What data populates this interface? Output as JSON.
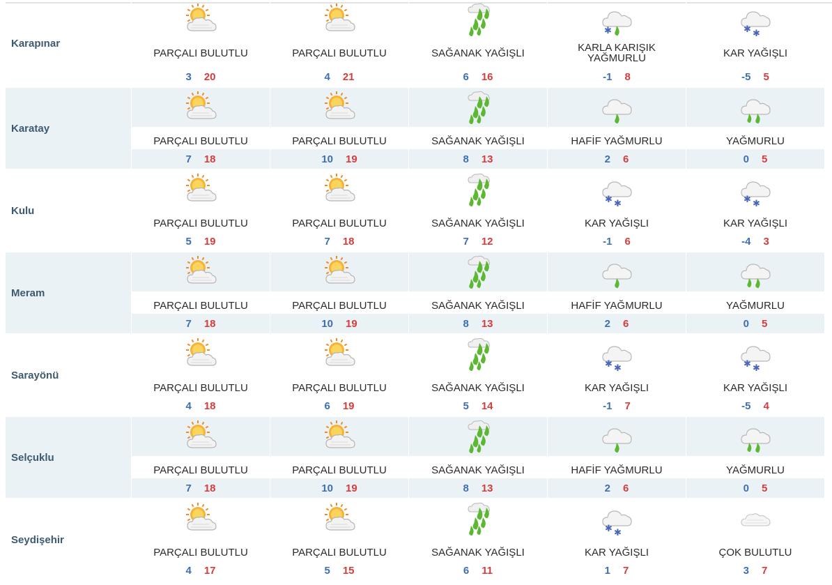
{
  "rows": [
    {
      "city": "Karapınar",
      "days": [
        {
          "icon": "partly-cloudy-icon",
          "condition": "PARÇALI BULUTLU",
          "min": "3",
          "max": "20"
        },
        {
          "icon": "partly-cloudy-icon",
          "condition": "PARÇALI BULUTLU",
          "min": "4",
          "max": "21"
        },
        {
          "icon": "shower-rain-icon",
          "condition": "SAĞANAK YAĞIŞLI",
          "min": "6",
          "max": "16"
        },
        {
          "icon": "sleet-icon",
          "condition": "KARLA KARIŞIK YAĞMURLU",
          "min": "-1",
          "max": "8"
        },
        {
          "icon": "snow-icon",
          "condition": "KAR YAĞIŞLI",
          "min": "-5",
          "max": "5"
        }
      ]
    },
    {
      "city": "Karatay",
      "days": [
        {
          "icon": "partly-cloudy-icon",
          "condition": "PARÇALI BULUTLU",
          "min": "7",
          "max": "18"
        },
        {
          "icon": "partly-cloudy-icon",
          "condition": "PARÇALI BULUTLU",
          "min": "10",
          "max": "19"
        },
        {
          "icon": "shower-rain-icon",
          "condition": "SAĞANAK YAĞIŞLI",
          "min": "8",
          "max": "13"
        },
        {
          "icon": "light-rain-icon",
          "condition": "HAFİF YAĞMURLU",
          "min": "2",
          "max": "6"
        },
        {
          "icon": "rain-icon",
          "condition": "YAĞMURLU",
          "min": "0",
          "max": "5"
        }
      ]
    },
    {
      "city": "Kulu",
      "days": [
        {
          "icon": "partly-cloudy-icon",
          "condition": "PARÇALI BULUTLU",
          "min": "5",
          "max": "19"
        },
        {
          "icon": "partly-cloudy-icon",
          "condition": "PARÇALI BULUTLU",
          "min": "7",
          "max": "18"
        },
        {
          "icon": "shower-rain-icon",
          "condition": "SAĞANAK YAĞIŞLI",
          "min": "7",
          "max": "12"
        },
        {
          "icon": "snow-icon",
          "condition": "KAR YAĞIŞLI",
          "min": "-1",
          "max": "6"
        },
        {
          "icon": "snow-icon",
          "condition": "KAR YAĞIŞLI",
          "min": "-4",
          "max": "3"
        }
      ]
    },
    {
      "city": "Meram",
      "days": [
        {
          "icon": "partly-cloudy-icon",
          "condition": "PARÇALI BULUTLU",
          "min": "7",
          "max": "18"
        },
        {
          "icon": "partly-cloudy-icon",
          "condition": "PARÇALI BULUTLU",
          "min": "10",
          "max": "19"
        },
        {
          "icon": "shower-rain-icon",
          "condition": "SAĞANAK YAĞIŞLI",
          "min": "8",
          "max": "13"
        },
        {
          "icon": "light-rain-icon",
          "condition": "HAFİF YAĞMURLU",
          "min": "2",
          "max": "6"
        },
        {
          "icon": "rain-icon",
          "condition": "YAĞMURLU",
          "min": "0",
          "max": "5"
        }
      ]
    },
    {
      "city": "Sarayönü",
      "days": [
        {
          "icon": "partly-cloudy-icon",
          "condition": "PARÇALI BULUTLU",
          "min": "4",
          "max": "18"
        },
        {
          "icon": "partly-cloudy-icon",
          "condition": "PARÇALI BULUTLU",
          "min": "6",
          "max": "19"
        },
        {
          "icon": "shower-rain-icon",
          "condition": "SAĞANAK YAĞIŞLI",
          "min": "5",
          "max": "14"
        },
        {
          "icon": "snow-icon",
          "condition": "KAR YAĞIŞLI",
          "min": "-1",
          "max": "7"
        },
        {
          "icon": "snow-icon",
          "condition": "KAR YAĞIŞLI",
          "min": "-5",
          "max": "4"
        }
      ]
    },
    {
      "city": "Selçuklu",
      "days": [
        {
          "icon": "partly-cloudy-icon",
          "condition": "PARÇALI BULUTLU",
          "min": "7",
          "max": "18"
        },
        {
          "icon": "partly-cloudy-icon",
          "condition": "PARÇALI BULUTLU",
          "min": "10",
          "max": "19"
        },
        {
          "icon": "shower-rain-icon",
          "condition": "SAĞANAK YAĞIŞLI",
          "min": "8",
          "max": "13"
        },
        {
          "icon": "light-rain-icon",
          "condition": "HAFİF YAĞMURLU",
          "min": "2",
          "max": "6"
        },
        {
          "icon": "rain-icon",
          "condition": "YAĞMURLU",
          "min": "0",
          "max": "5"
        }
      ]
    },
    {
      "city": "Seydişehir",
      "days": [
        {
          "icon": "partly-cloudy-icon",
          "condition": "PARÇALI BULUTLU",
          "min": "4",
          "max": "17"
        },
        {
          "icon": "partly-cloudy-icon",
          "condition": "PARÇALI BULUTLU",
          "min": "5",
          "max": "15"
        },
        {
          "icon": "shower-rain-icon",
          "condition": "SAĞANAK YAĞIŞLI",
          "min": "6",
          "max": "11"
        },
        {
          "icon": "snow-icon",
          "condition": "KAR YAĞIŞLI",
          "min": "1",
          "max": "7"
        },
        {
          "icon": "cloudy-icon",
          "condition": "ÇOK BULUTLU",
          "min": "3",
          "max": "7"
        }
      ]
    }
  ],
  "colors": {
    "min_temp": "#3c6fb4",
    "max_temp": "#d63c3c",
    "city": "#3d5a70",
    "shade": "#ebf2f6"
  }
}
